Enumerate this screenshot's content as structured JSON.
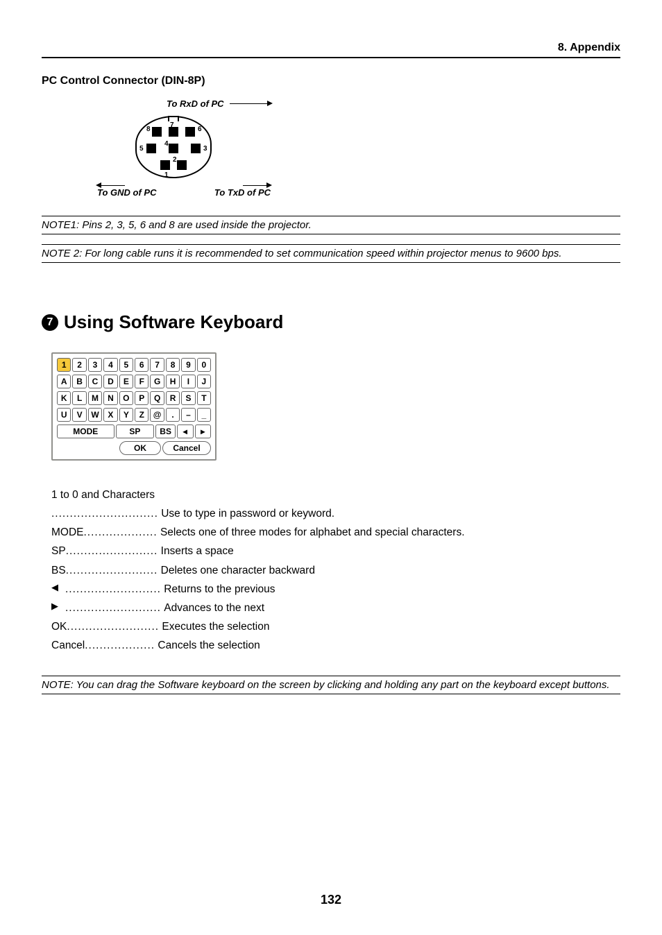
{
  "chapter": "8. Appendix",
  "subheader": "PC Control Connector (DIN-8P)",
  "connector": {
    "rxd_label": "To RxD of PC",
    "gnd_label": "To GND of PC",
    "txd_label": "To TxD of PC",
    "pins": [
      "1",
      "2",
      "3",
      "4",
      "5",
      "6",
      "7",
      "8"
    ]
  },
  "note1": "NOTE1: Pins 2, 3, 5, 6 and 8 are used inside the projector.",
  "note2": "NOTE 2: For long cable runs it is recommended to set communication speed within projector menus to 9600 bps.",
  "section": {
    "number": "7",
    "title": "Using Software Keyboard"
  },
  "keyboard": {
    "row1": [
      "1",
      "2",
      "3",
      "4",
      "5",
      "6",
      "7",
      "8",
      "9",
      "0"
    ],
    "row2": [
      "A",
      "B",
      "C",
      "D",
      "E",
      "F",
      "G",
      "H",
      "I",
      "J"
    ],
    "row3": [
      "K",
      "L",
      "M",
      "N",
      "O",
      "P",
      "Q",
      "R",
      "S",
      "T"
    ],
    "row4": [
      "U",
      "V",
      "W",
      "X",
      "Y",
      "Z",
      "@",
      ".",
      "–",
      "_"
    ],
    "row5": {
      "mode": "MODE",
      "sp": "SP",
      "bs": "BS",
      "left": "◂",
      "right": "▸"
    },
    "row6": {
      "ok": "OK",
      "cancel": "Cancel"
    }
  },
  "definitions": {
    "header": "1 to 0 and Characters",
    "rows": [
      {
        "term": " ",
        "dots": ".............................",
        "desc": "Use to type in password or keyword."
      },
      {
        "term": "MODE",
        "dots": "....................",
        "desc": "Selects one of three modes for alphabet and special characters."
      },
      {
        "term": "SP",
        "dots": ".........................",
        "desc": "Inserts a space"
      },
      {
        "term": "BS",
        "dots": ".........................",
        "desc": "Deletes one character backward"
      },
      {
        "term": "◀",
        "dots": "..........................",
        "desc": "Returns to the previous"
      },
      {
        "term": "▶",
        "dots": "..........................",
        "desc": "Advances to the next"
      },
      {
        "term": "OK",
        "dots": ".........................",
        "desc": "Executes the selection"
      },
      {
        "term": "Cancel",
        "dots": "...................",
        "desc": "Cancels the selection"
      }
    ]
  },
  "note_final": "NOTE: You can drag the Software keyboard on the screen by clicking and holding any part on the keyboard except buttons.",
  "page_number": "132"
}
